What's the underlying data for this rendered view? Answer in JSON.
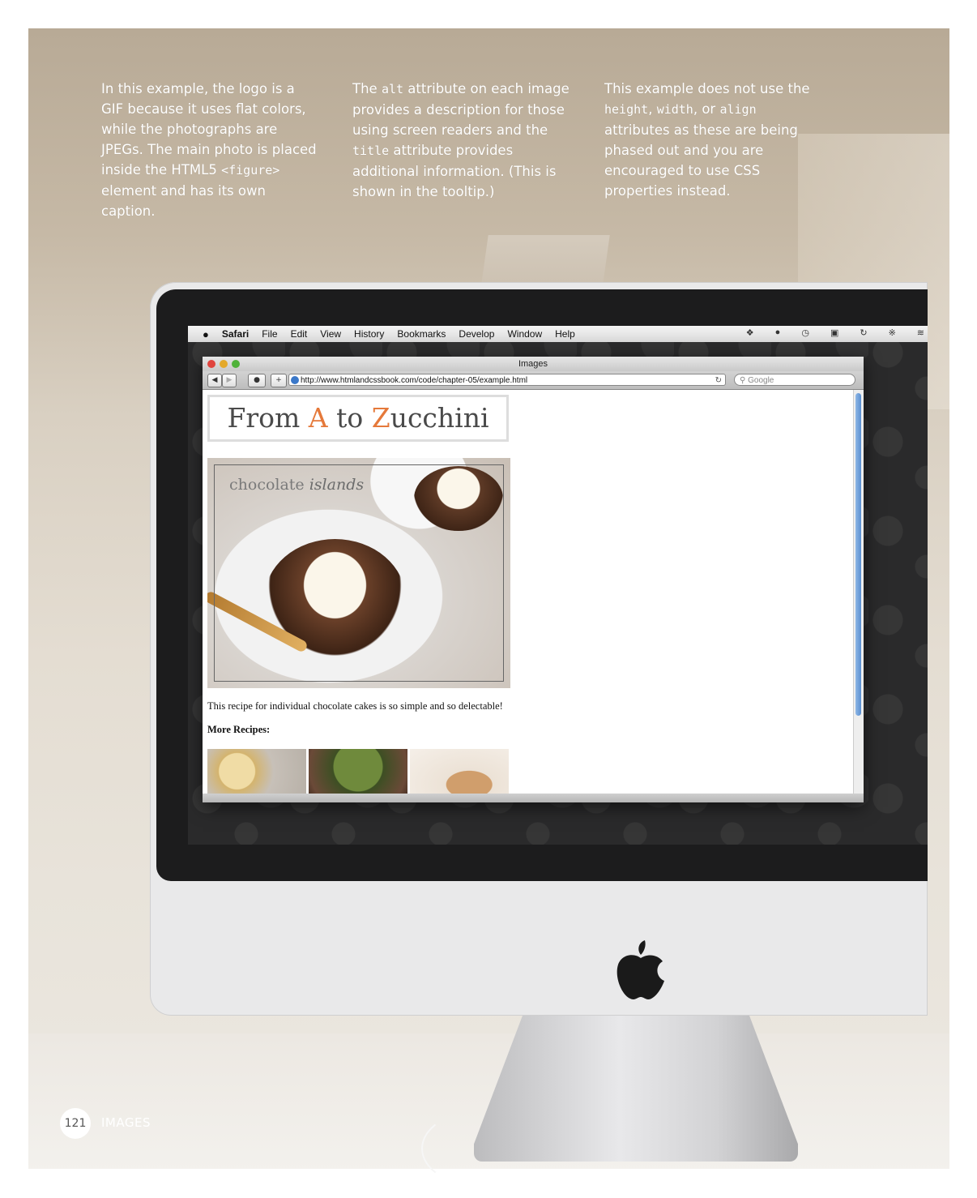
{
  "columns": [
    {
      "text_html": "In this example, the logo is a GIF because it uses flat colors, while the photographs are JPEGs. The main photo is placed inside the HTML5 <code>&lt;figure&gt;</code> element and has its own caption."
    },
    {
      "text_html": "The <code>alt</code> attribute on each image provides a description for those using screen readers and the <code>title</code> attribute provides additional information. (This is shown in the tooltip.)"
    },
    {
      "text_html": "This example does not use the <code>height</code>, <code>width</code>, or <code>align</code> attributes as these are being phased out and you are encouraged to use CSS properties instead."
    }
  ],
  "menubar": {
    "items": [
      "Safari",
      "File",
      "Edit",
      "View",
      "History",
      "Bookmarks",
      "Develop",
      "Window",
      "Help"
    ]
  },
  "browser": {
    "window_title": "Images",
    "url": "http://www.htmlandcssbook.com/code/chapter-05/example.html",
    "search_placeholder": "Google"
  },
  "page": {
    "logo_prefix": "From ",
    "logo_a": "A",
    "logo_mid": " to ",
    "logo_z": "Z",
    "logo_suffix": "ucchini",
    "hero_title": "chocolate",
    "hero_title_script": "islands",
    "caption": "This recipe for individual chocolate cakes is so simple and so delectable!",
    "more_recipes": "More Recipes:"
  },
  "footer": {
    "page_number": "121",
    "section": "IMAGES"
  },
  "colors": {
    "logo_accent": "#e5793a",
    "scroll_thumb": "#5a8fd0"
  }
}
